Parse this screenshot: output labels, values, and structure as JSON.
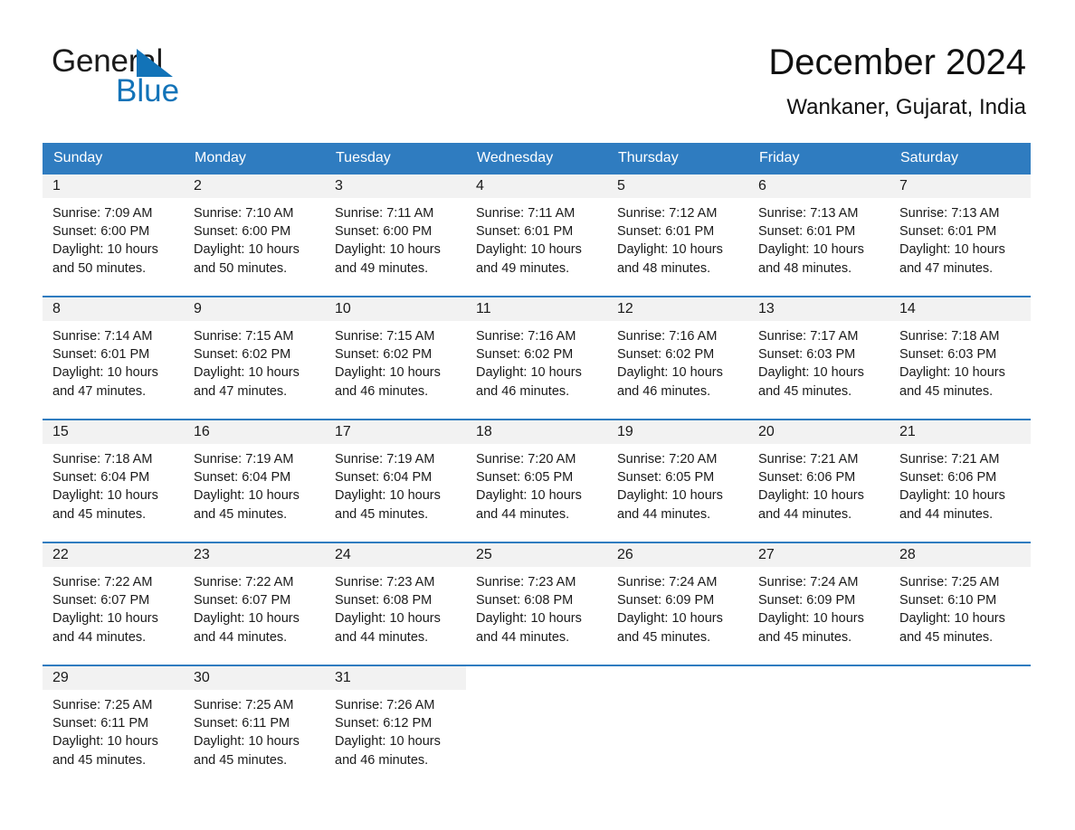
{
  "brand": {
    "name_line1": "General",
    "name_line2": "Blue",
    "logo_black": "#1b1b1b",
    "logo_blue": "#1273b8"
  },
  "header": {
    "title": "December 2024",
    "location": "Wankaner, Gujarat, India"
  },
  "theme": {
    "header_blue": "#2f7cc0",
    "daynum_band": "#f2f2f2",
    "text": "#1a1a1a",
    "page_background": "#ffffff"
  },
  "weekday_headers": [
    "Sunday",
    "Monday",
    "Tuesday",
    "Wednesday",
    "Thursday",
    "Friday",
    "Saturday"
  ],
  "weeks": [
    [
      {
        "day": "1",
        "sunrise": "Sunrise: 7:09 AM",
        "sunset": "Sunset: 6:00 PM",
        "daylight_1": "Daylight: 10 hours",
        "daylight_2": "and 50 minutes."
      },
      {
        "day": "2",
        "sunrise": "Sunrise: 7:10 AM",
        "sunset": "Sunset: 6:00 PM",
        "daylight_1": "Daylight: 10 hours",
        "daylight_2": "and 50 minutes."
      },
      {
        "day": "3",
        "sunrise": "Sunrise: 7:11 AM",
        "sunset": "Sunset: 6:00 PM",
        "daylight_1": "Daylight: 10 hours",
        "daylight_2": "and 49 minutes."
      },
      {
        "day": "4",
        "sunrise": "Sunrise: 7:11 AM",
        "sunset": "Sunset: 6:01 PM",
        "daylight_1": "Daylight: 10 hours",
        "daylight_2": "and 49 minutes."
      },
      {
        "day": "5",
        "sunrise": "Sunrise: 7:12 AM",
        "sunset": "Sunset: 6:01 PM",
        "daylight_1": "Daylight: 10 hours",
        "daylight_2": "and 48 minutes."
      },
      {
        "day": "6",
        "sunrise": "Sunrise: 7:13 AM",
        "sunset": "Sunset: 6:01 PM",
        "daylight_1": "Daylight: 10 hours",
        "daylight_2": "and 48 minutes."
      },
      {
        "day": "7",
        "sunrise": "Sunrise: 7:13 AM",
        "sunset": "Sunset: 6:01 PM",
        "daylight_1": "Daylight: 10 hours",
        "daylight_2": "and 47 minutes."
      }
    ],
    [
      {
        "day": "8",
        "sunrise": "Sunrise: 7:14 AM",
        "sunset": "Sunset: 6:01 PM",
        "daylight_1": "Daylight: 10 hours",
        "daylight_2": "and 47 minutes."
      },
      {
        "day": "9",
        "sunrise": "Sunrise: 7:15 AM",
        "sunset": "Sunset: 6:02 PM",
        "daylight_1": "Daylight: 10 hours",
        "daylight_2": "and 47 minutes."
      },
      {
        "day": "10",
        "sunrise": "Sunrise: 7:15 AM",
        "sunset": "Sunset: 6:02 PM",
        "daylight_1": "Daylight: 10 hours",
        "daylight_2": "and 46 minutes."
      },
      {
        "day": "11",
        "sunrise": "Sunrise: 7:16 AM",
        "sunset": "Sunset: 6:02 PM",
        "daylight_1": "Daylight: 10 hours",
        "daylight_2": "and 46 minutes."
      },
      {
        "day": "12",
        "sunrise": "Sunrise: 7:16 AM",
        "sunset": "Sunset: 6:02 PM",
        "daylight_1": "Daylight: 10 hours",
        "daylight_2": "and 46 minutes."
      },
      {
        "day": "13",
        "sunrise": "Sunrise: 7:17 AM",
        "sunset": "Sunset: 6:03 PM",
        "daylight_1": "Daylight: 10 hours",
        "daylight_2": "and 45 minutes."
      },
      {
        "day": "14",
        "sunrise": "Sunrise: 7:18 AM",
        "sunset": "Sunset: 6:03 PM",
        "daylight_1": "Daylight: 10 hours",
        "daylight_2": "and 45 minutes."
      }
    ],
    [
      {
        "day": "15",
        "sunrise": "Sunrise: 7:18 AM",
        "sunset": "Sunset: 6:04 PM",
        "daylight_1": "Daylight: 10 hours",
        "daylight_2": "and 45 minutes."
      },
      {
        "day": "16",
        "sunrise": "Sunrise: 7:19 AM",
        "sunset": "Sunset: 6:04 PM",
        "daylight_1": "Daylight: 10 hours",
        "daylight_2": "and 45 minutes."
      },
      {
        "day": "17",
        "sunrise": "Sunrise: 7:19 AM",
        "sunset": "Sunset: 6:04 PM",
        "daylight_1": "Daylight: 10 hours",
        "daylight_2": "and 45 minutes."
      },
      {
        "day": "18",
        "sunrise": "Sunrise: 7:20 AM",
        "sunset": "Sunset: 6:05 PM",
        "daylight_1": "Daylight: 10 hours",
        "daylight_2": "and 44 minutes."
      },
      {
        "day": "19",
        "sunrise": "Sunrise: 7:20 AM",
        "sunset": "Sunset: 6:05 PM",
        "daylight_1": "Daylight: 10 hours",
        "daylight_2": "and 44 minutes."
      },
      {
        "day": "20",
        "sunrise": "Sunrise: 7:21 AM",
        "sunset": "Sunset: 6:06 PM",
        "daylight_1": "Daylight: 10 hours",
        "daylight_2": "and 44 minutes."
      },
      {
        "day": "21",
        "sunrise": "Sunrise: 7:21 AM",
        "sunset": "Sunset: 6:06 PM",
        "daylight_1": "Daylight: 10 hours",
        "daylight_2": "and 44 minutes."
      }
    ],
    [
      {
        "day": "22",
        "sunrise": "Sunrise: 7:22 AM",
        "sunset": "Sunset: 6:07 PM",
        "daylight_1": "Daylight: 10 hours",
        "daylight_2": "and 44 minutes."
      },
      {
        "day": "23",
        "sunrise": "Sunrise: 7:22 AM",
        "sunset": "Sunset: 6:07 PM",
        "daylight_1": "Daylight: 10 hours",
        "daylight_2": "and 44 minutes."
      },
      {
        "day": "24",
        "sunrise": "Sunrise: 7:23 AM",
        "sunset": "Sunset: 6:08 PM",
        "daylight_1": "Daylight: 10 hours",
        "daylight_2": "and 44 minutes."
      },
      {
        "day": "25",
        "sunrise": "Sunrise: 7:23 AM",
        "sunset": "Sunset: 6:08 PM",
        "daylight_1": "Daylight: 10 hours",
        "daylight_2": "and 44 minutes."
      },
      {
        "day": "26",
        "sunrise": "Sunrise: 7:24 AM",
        "sunset": "Sunset: 6:09 PM",
        "daylight_1": "Daylight: 10 hours",
        "daylight_2": "and 45 minutes."
      },
      {
        "day": "27",
        "sunrise": "Sunrise: 7:24 AM",
        "sunset": "Sunset: 6:09 PM",
        "daylight_1": "Daylight: 10 hours",
        "daylight_2": "and 45 minutes."
      },
      {
        "day": "28",
        "sunrise": "Sunrise: 7:25 AM",
        "sunset": "Sunset: 6:10 PM",
        "daylight_1": "Daylight: 10 hours",
        "daylight_2": "and 45 minutes."
      }
    ],
    [
      {
        "day": "29",
        "sunrise": "Sunrise: 7:25 AM",
        "sunset": "Sunset: 6:11 PM",
        "daylight_1": "Daylight: 10 hours",
        "daylight_2": "and 45 minutes."
      },
      {
        "day": "30",
        "sunrise": "Sunrise: 7:25 AM",
        "sunset": "Sunset: 6:11 PM",
        "daylight_1": "Daylight: 10 hours",
        "daylight_2": "and 45 minutes."
      },
      {
        "day": "31",
        "sunrise": "Sunrise: 7:26 AM",
        "sunset": "Sunset: 6:12 PM",
        "daylight_1": "Daylight: 10 hours",
        "daylight_2": "and 46 minutes."
      },
      {
        "day": "",
        "sunrise": "",
        "sunset": "",
        "daylight_1": "",
        "daylight_2": ""
      },
      {
        "day": "",
        "sunrise": "",
        "sunset": "",
        "daylight_1": "",
        "daylight_2": ""
      },
      {
        "day": "",
        "sunrise": "",
        "sunset": "",
        "daylight_1": "",
        "daylight_2": ""
      },
      {
        "day": "",
        "sunrise": "",
        "sunset": "",
        "daylight_1": "",
        "daylight_2": ""
      }
    ]
  ]
}
